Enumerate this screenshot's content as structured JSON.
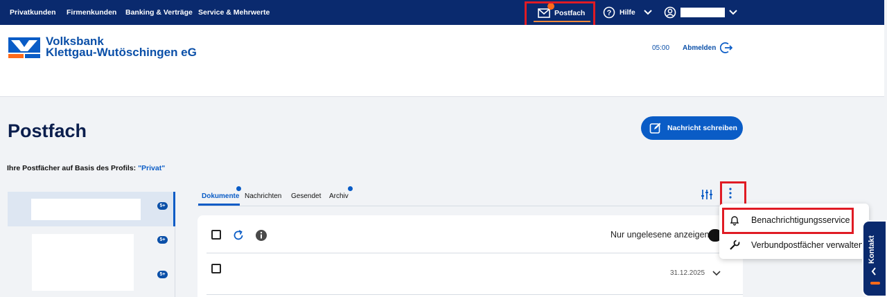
{
  "topnav": {
    "items": [
      "Privatkunden",
      "Firmenkunden",
      "Banking & Verträge",
      "Service & Mehrwerte"
    ],
    "postfach": "Postfach",
    "hilfe": "Hilfe"
  },
  "header": {
    "bank_line1": "Volksbank",
    "bank_line2": "Klettgau-Wutöschingen eG",
    "timer": "05:00",
    "logout": "Abmelden"
  },
  "main": {
    "title": "Postfach",
    "write_button": "Nachricht schreiben",
    "profile_prefix": "Ihre Postfächer auf Basis des Profils: ",
    "profile_name": "\"Privat\""
  },
  "sidebar": {
    "badges": [
      "5+",
      "5+",
      "5+"
    ]
  },
  "tabs": [
    {
      "label": "Dokumente",
      "active": true,
      "dot": true
    },
    {
      "label": "Nachrichten",
      "active": false,
      "dot": false
    },
    {
      "label": "Gesendet",
      "active": false,
      "dot": false
    },
    {
      "label": "Archiv",
      "active": false,
      "dot": true
    }
  ],
  "list": {
    "unread_toggle_label": "Nur ungelesene anzeigen",
    "rows": [
      {
        "date": "31.12.2025"
      }
    ]
  },
  "menu": {
    "items": [
      "Benachrichtigungsservice",
      "Verbundpostfächer verwalten"
    ]
  },
  "contact": {
    "label": "Kontakt"
  },
  "colors": {
    "nav_bg": "#0a2a6e",
    "accent": "#0a5cc6",
    "highlight": "#e01b24",
    "notification": "#ff6a1a"
  }
}
